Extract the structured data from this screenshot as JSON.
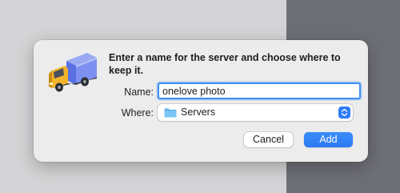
{
  "dialog": {
    "message": "Enter a name for the server and choose where to keep it.",
    "app_icon": "transmit-truck-icon",
    "name_field": {
      "label": "Name:",
      "value": "onelove photo"
    },
    "where_field": {
      "label": "Where:",
      "selected": "Servers",
      "icon": "folder-icon"
    },
    "buttons": {
      "cancel": "Cancel",
      "add": "Add"
    }
  },
  "colors": {
    "accent": "#2f7bf6",
    "dialog_bg": "#ececec",
    "desktop_left": "#d4d4d6",
    "desktop_right": "#6e6f76"
  }
}
